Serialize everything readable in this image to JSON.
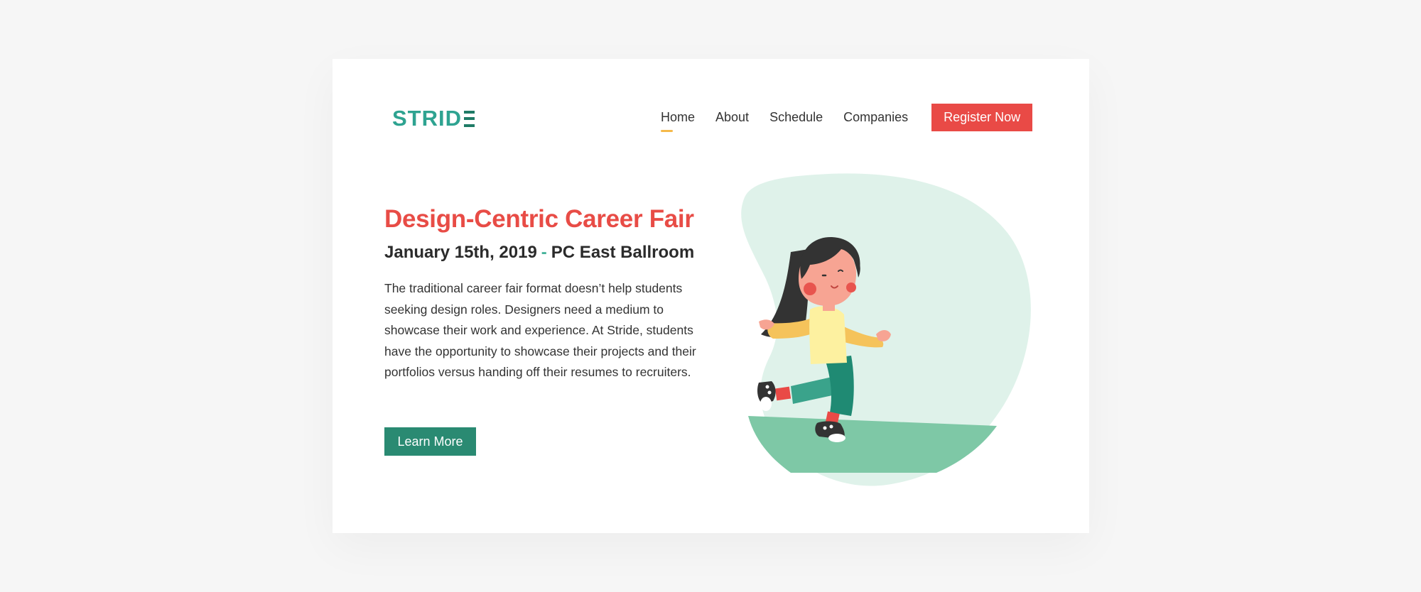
{
  "brand": {
    "name": "STRID",
    "accent": "#2ea391"
  },
  "nav": {
    "items": [
      {
        "label": "Home",
        "active": true
      },
      {
        "label": "About"
      },
      {
        "label": "Schedule"
      },
      {
        "label": "Companies"
      }
    ],
    "cta_label": "Register Now"
  },
  "hero": {
    "title": "Design-Centric Career Fair",
    "date": "January 15th, 2019",
    "separator": "-",
    "location": "PC East Ballroom",
    "description": "The traditional career fair format doesn’t help students seeking design roles. Designers need a medium to showcase their work and experience. At Stride, students have the opportunity to showcase their projects and their portfolios versus handing off their resumes to recruiters.",
    "button_label": "Learn More"
  },
  "colors": {
    "primary_red": "#e94a46",
    "primary_green": "#2a8a72",
    "blob": "#dff2ea",
    "ground": "#7ec8a6"
  }
}
